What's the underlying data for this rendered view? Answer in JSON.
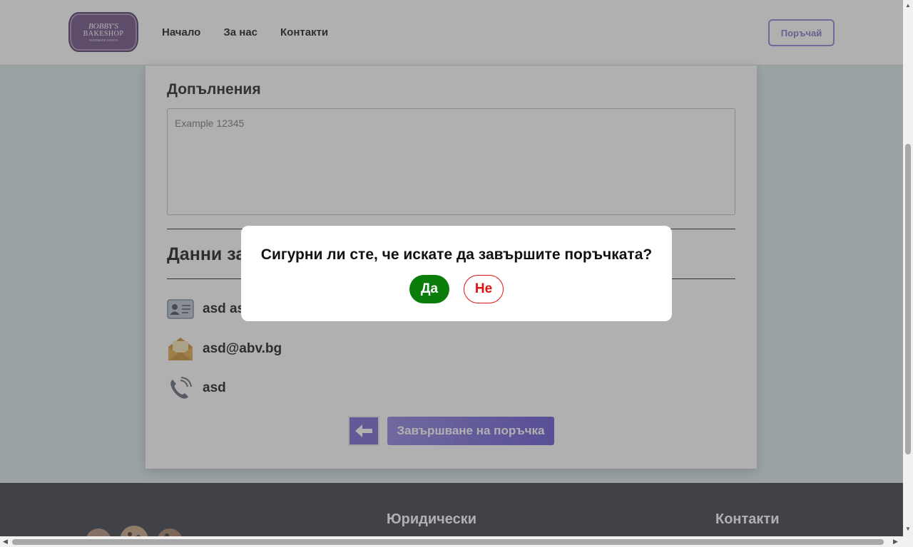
{
  "header": {
    "logo": {
      "line1": "BOBBY'S",
      "line2": "BAKESHOP",
      "line3": "HANDMADE SWEETS"
    },
    "nav": [
      "Начало",
      "За нас",
      "Контакти"
    ],
    "order_label": "Поръчай"
  },
  "form": {
    "notes_title": "Допълнения",
    "notes_placeholder": "Example 12345",
    "data_title": "Данни за поръчката",
    "name_value": "asd asd",
    "email_value": "asd@abv.bg",
    "phone_value": "asd",
    "finish_label": "Завършване на поръчка"
  },
  "footer": {
    "legal_title": "Юридически",
    "contacts_title": "Контакти"
  },
  "modal": {
    "question": "Сигурни ли сте, че искате да завършите поръчката?",
    "yes_label": "Да",
    "no_label": "Не"
  },
  "colors": {
    "accent": "#6f62d4",
    "yes": "#0a7d0a",
    "no": "#dd1111",
    "footer": "#343840"
  },
  "icons": [
    "id-card-icon",
    "envelope-icon",
    "phone-icon",
    "arrow-left-icon"
  ]
}
